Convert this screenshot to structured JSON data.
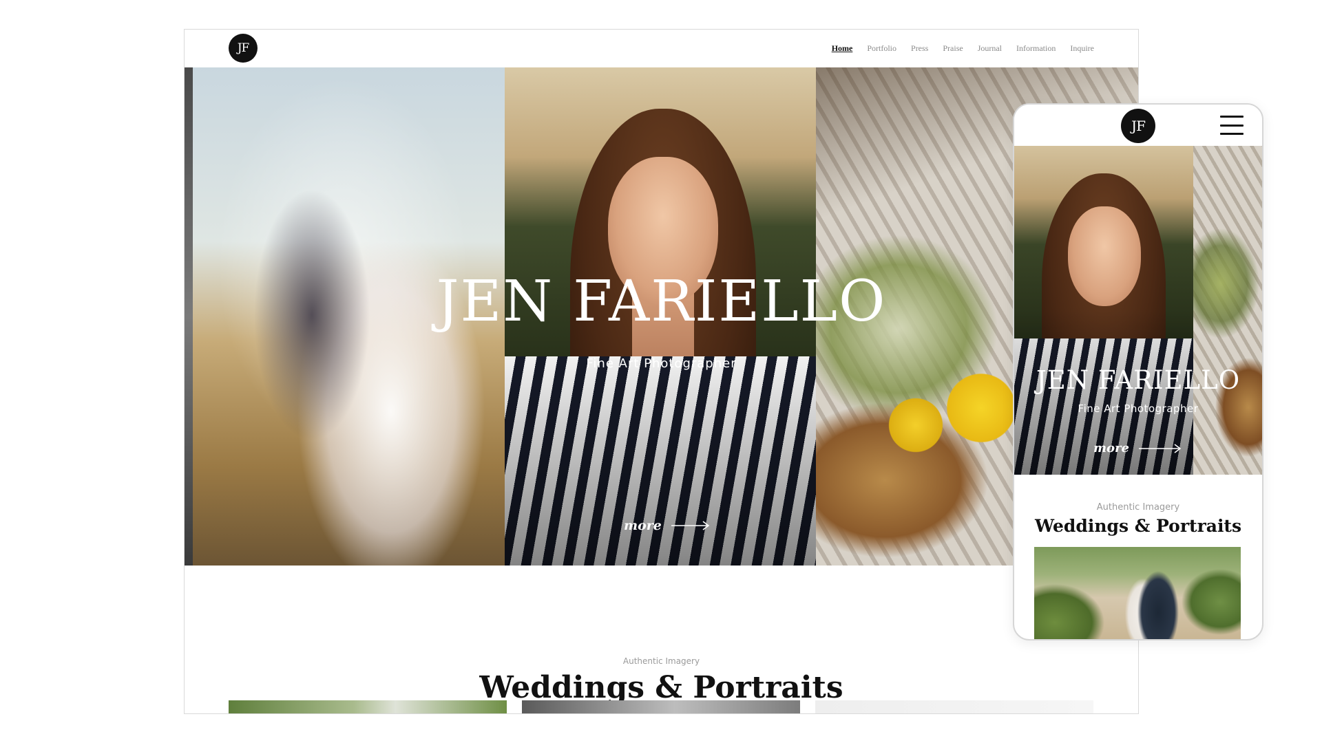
{
  "brand": {
    "logo_text": "JF",
    "name": "JEN FARIELLO",
    "tagline": "Fine Art Photographer"
  },
  "nav": {
    "items": [
      {
        "label": "Home",
        "active": true
      },
      {
        "label": "Portfolio",
        "active": false
      },
      {
        "label": "Press",
        "active": false
      },
      {
        "label": "Praise",
        "active": false
      },
      {
        "label": "Journal",
        "active": false
      },
      {
        "label": "Information",
        "active": false
      },
      {
        "label": "Inquire",
        "active": false
      }
    ]
  },
  "hero": {
    "title": "JEN FARIELLO",
    "subtitle": "Fine Art Photographer",
    "more_label": "more"
  },
  "section": {
    "eyebrow": "Authentic Imagery",
    "title": "Weddings & Portraits"
  },
  "mobile": {
    "logo_text": "JF",
    "hero_title": "JEN FARIELLO",
    "hero_subtitle": "Fine Art Photographer",
    "more_label": "more",
    "eyebrow": "Authentic Imagery",
    "section_title": "Weddings & Portraits"
  },
  "icons": {
    "menu": "hamburger-menu-icon",
    "arrow": "arrow-right-icon"
  },
  "colors": {
    "text_dark": "#111111",
    "nav_muted": "#8a8a8a",
    "eyebrow": "#9a9a9a",
    "logo_bg": "#111111"
  }
}
